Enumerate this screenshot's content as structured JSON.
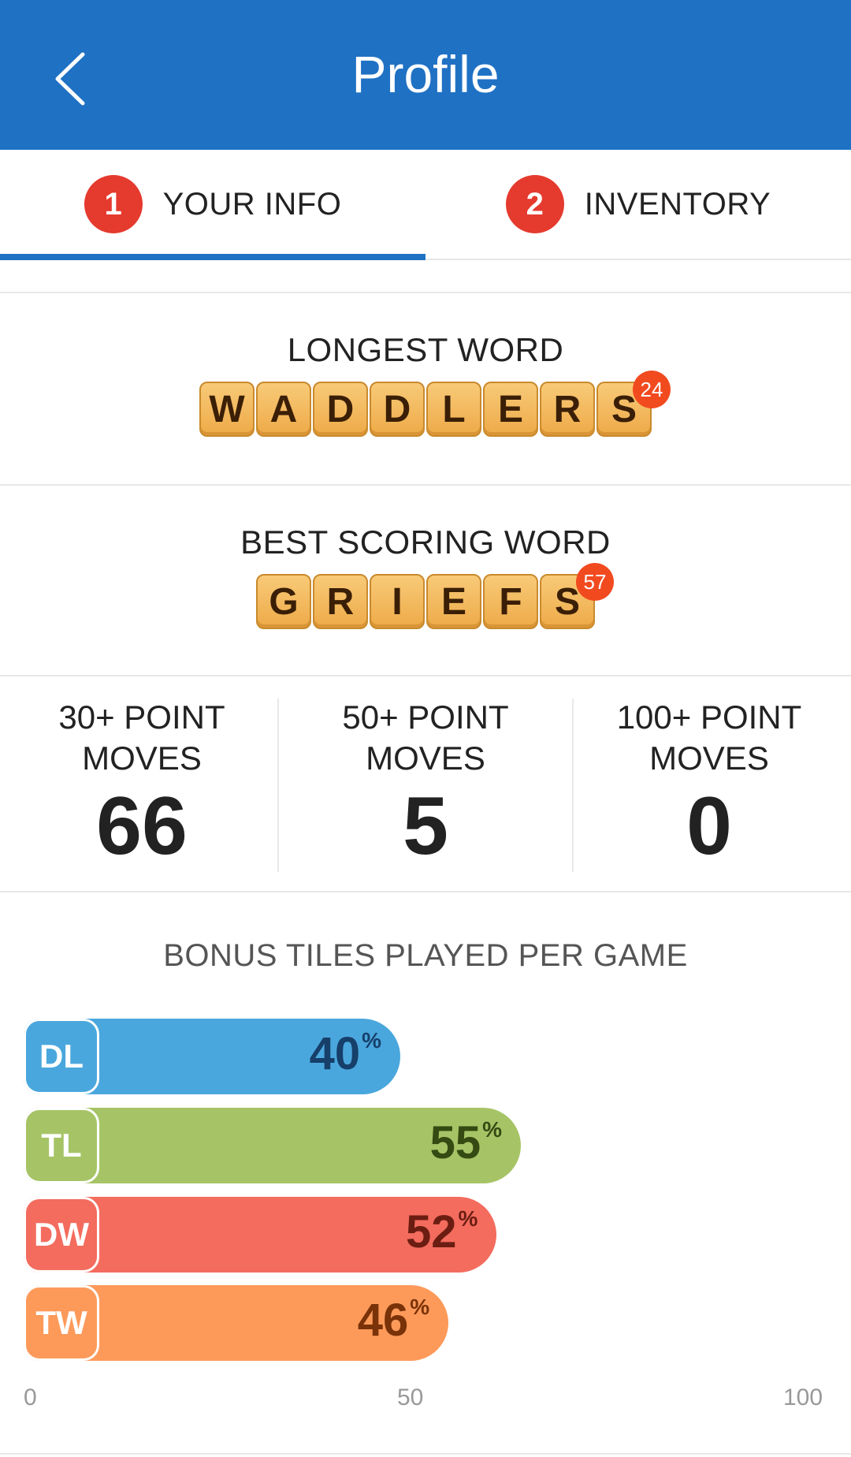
{
  "header": {
    "title": "Profile",
    "back_icon": "chevron-left-icon"
  },
  "tabs": [
    {
      "badge": "1",
      "label": "YOUR INFO",
      "active": true
    },
    {
      "badge": "2",
      "label": "INVENTORY",
      "active": false
    }
  ],
  "longest_word": {
    "title": "LONGEST WORD",
    "letters": [
      "W",
      "A",
      "D",
      "D",
      "L",
      "E",
      "R",
      "S"
    ],
    "score": "24"
  },
  "best_word": {
    "title": "BEST SCORING WORD",
    "letters": [
      "G",
      "R",
      "I",
      "E",
      "F",
      "S"
    ],
    "score": "57"
  },
  "stats": [
    {
      "label_line1": "30+ POINT",
      "label_line2": "MOVES",
      "value": "66"
    },
    {
      "label_line1": "50+ POINT",
      "label_line2": "MOVES",
      "value": "5"
    },
    {
      "label_line1": "100+ POINT",
      "label_line2": "MOVES",
      "value": "0"
    }
  ],
  "colors": {
    "primary": "#1f71c4",
    "badge": "#e53a2e",
    "score_badge": "#f24a1f"
  },
  "chart_data": {
    "type": "bar",
    "title": "BONUS TILES PLAYED PER GAME",
    "orientation": "horizontal",
    "categories": [
      "DL",
      "TL",
      "DW",
      "TW"
    ],
    "values": [
      40,
      55,
      52,
      46
    ],
    "unit": "%",
    "xlim": [
      0,
      100
    ],
    "xticks": [
      "0",
      "50",
      "100"
    ],
    "colors": [
      "#4aa7dd",
      "#a6c466",
      "#f36c5e",
      "#fd9a5a"
    ],
    "value_colors": [
      "#163f6a",
      "#354a12",
      "#6b1d12",
      "#7a3208"
    ]
  }
}
